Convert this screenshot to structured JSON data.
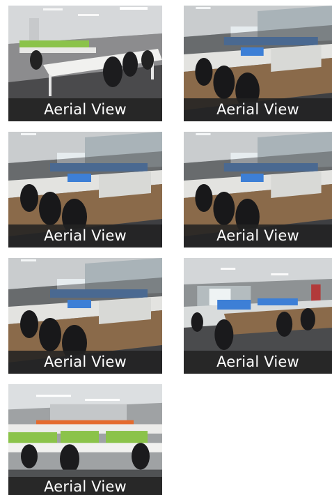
{
  "gallery": {
    "items": [
      {
        "caption": "Aerial View",
        "icon": "office-photo-green-desks"
      },
      {
        "caption": "Aerial View",
        "icon": "office-photo-blue-partitions"
      },
      {
        "caption": "Aerial View",
        "icon": "office-photo-blue-partitions"
      },
      {
        "caption": "Aerial View",
        "icon": "office-photo-blue-partitions"
      },
      {
        "caption": "Aerial View",
        "icon": "office-photo-blue-partitions"
      },
      {
        "caption": "Aerial View",
        "icon": "office-photo-window-wall"
      },
      {
        "caption": "Aerial View",
        "icon": "office-photo-green-orange-desks"
      }
    ]
  },
  "colors": {
    "caption_background": "#222222",
    "caption_text": "#ffffff",
    "partition_green": "#8bc34a",
    "partition_blue": "#3d7fd6",
    "desk_wood": "#8a6a4a"
  }
}
